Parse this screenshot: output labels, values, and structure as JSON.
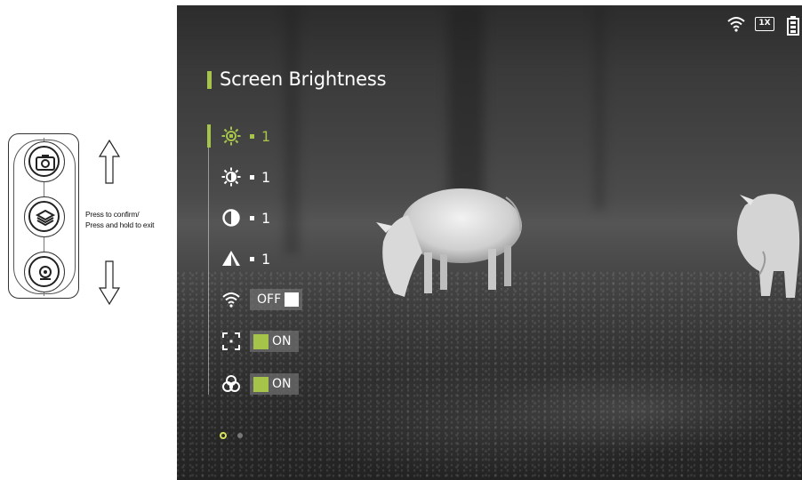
{
  "instructions": {
    "line1": "Press to confirm/",
    "line2": "Press and hold to exit"
  },
  "device": {
    "buttons": [
      {
        "icon": "camera-icon"
      },
      {
        "icon": "layers-icon"
      },
      {
        "icon": "record-icon"
      }
    ],
    "arrows": [
      "arrow-up-icon",
      "arrow-down-icon"
    ]
  },
  "status": {
    "zoom": "1X",
    "icons": [
      "wifi-icon",
      "battery-icon"
    ]
  },
  "menu": {
    "title": "Screen Brightness",
    "items": [
      {
        "icon": "brightness-icon",
        "value": "1",
        "active": true
      },
      {
        "icon": "brightness-icon",
        "value": "1"
      },
      {
        "icon": "contrast-icon",
        "value": "1"
      },
      {
        "icon": "sharpness-icon",
        "value": "1"
      },
      {
        "icon": "wifi-icon",
        "toggle": "OFF"
      },
      {
        "icon": "crosshair-icon",
        "toggle": "ON"
      },
      {
        "icon": "color-palette-icon",
        "toggle": "ON"
      }
    ],
    "page": {
      "current": 1,
      "total": 2
    }
  },
  "colors": {
    "accent": "#a6c44a",
    "text": "#ffffff"
  }
}
